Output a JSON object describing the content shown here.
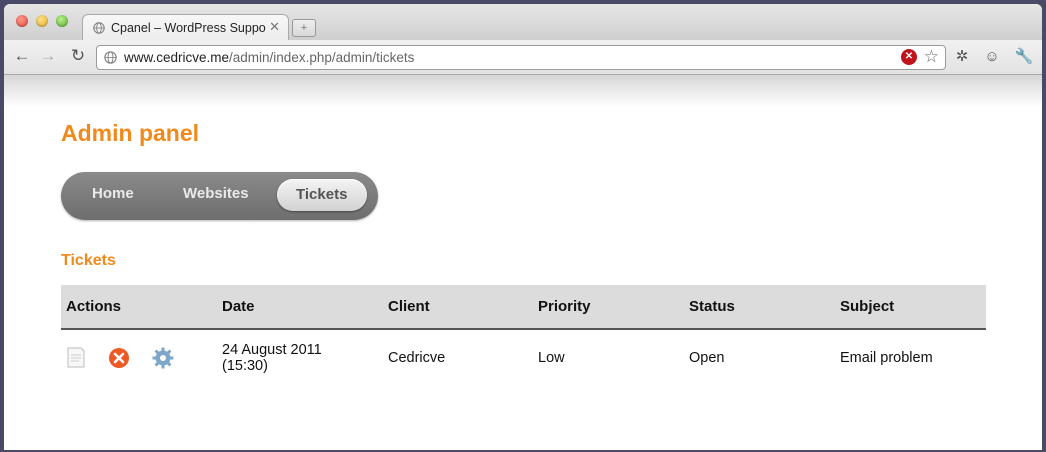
{
  "browser": {
    "tab_title": "Cpanel – WordPress Support",
    "url_host": "www.cedricve.me",
    "url_path": "/admin/index.php/admin/tickets"
  },
  "page": {
    "title": "Admin panel",
    "nav": {
      "home": "Home",
      "websites": "Websites",
      "tickets": "Tickets",
      "active": "Tickets"
    },
    "section_title": "Tickets",
    "table": {
      "headers": [
        "Actions",
        "Date",
        "Client",
        "Priority",
        "Status",
        "Subject"
      ],
      "rows": [
        {
          "actions": [
            "view-icon",
            "delete-icon",
            "settings-icon"
          ],
          "date": "24 August 2011",
          "time": "(15:30)",
          "client": "Cedricve",
          "priority": "Low",
          "status": "Open",
          "subject": "Email problem"
        }
      ]
    }
  },
  "colors": {
    "accent": "#f08a1c",
    "priority_low": "#1a7fd8",
    "status_open": "#1e8c1e"
  }
}
